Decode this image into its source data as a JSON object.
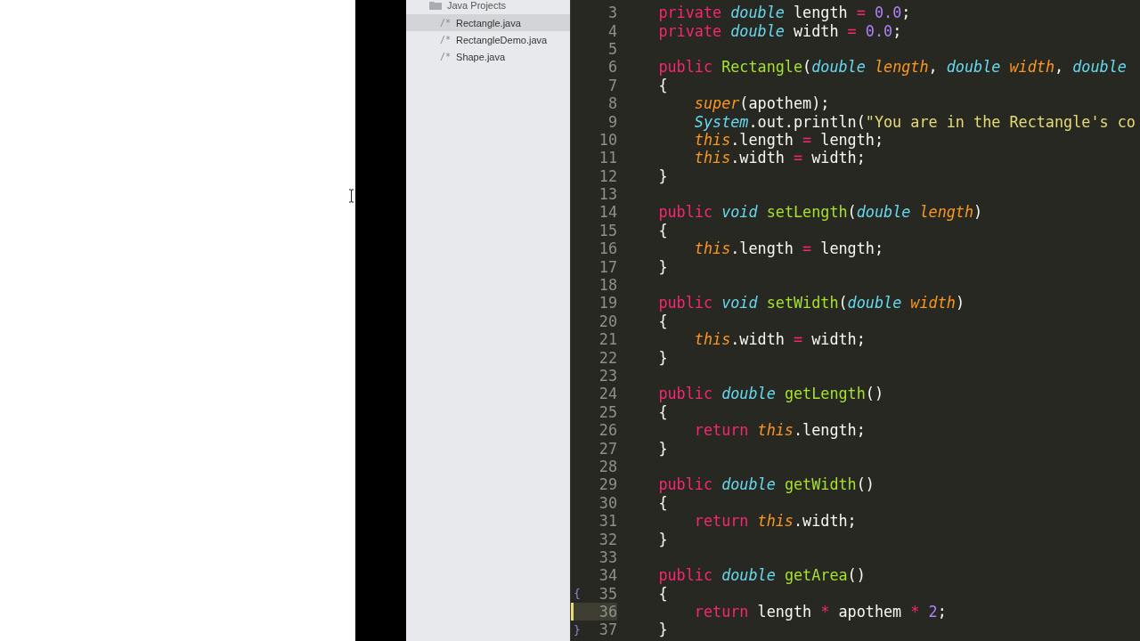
{
  "sidebar": {
    "header": "Java Projects",
    "items": [
      {
        "icon": "/*",
        "label": "Rectangle.java",
        "selected": true
      },
      {
        "icon": "/*",
        "label": "RectangleDemo.java",
        "selected": false
      },
      {
        "icon": "/*",
        "label": "Shape.java",
        "selected": false
      }
    ]
  },
  "editor": {
    "lines": [
      {
        "number": "3",
        "current": false,
        "tokens": [
          {
            "kind": "keyword",
            "text": "    private "
          },
          {
            "kind": "type",
            "text": "double"
          },
          {
            "kind": "plain",
            "text": " length "
          },
          {
            "kind": "operator",
            "text": "= "
          },
          {
            "kind": "number",
            "text": "0.0"
          },
          {
            "kind": "plain",
            "text": ";"
          }
        ]
      },
      {
        "number": "4",
        "current": false,
        "tokens": [
          {
            "kind": "keyword",
            "text": "    private "
          },
          {
            "kind": "type",
            "text": "double"
          },
          {
            "kind": "plain",
            "text": " width "
          },
          {
            "kind": "operator",
            "text": "= "
          },
          {
            "kind": "number",
            "text": "0.0"
          },
          {
            "kind": "plain",
            "text": ";"
          }
        ]
      },
      {
        "number": "5",
        "current": false
      },
      {
        "number": "6",
        "current": false,
        "tokens": [
          {
            "kind": "keyword",
            "text": "    public "
          },
          {
            "kind": "function",
            "text": "Rectangle"
          },
          {
            "kind": "plain",
            "text": "("
          },
          {
            "kind": "type",
            "text": "double "
          },
          {
            "kind": "parameter",
            "text": "length"
          },
          {
            "kind": "plain",
            "text": ", "
          },
          {
            "kind": "type",
            "text": "double "
          },
          {
            "kind": "parameter",
            "text": "width"
          },
          {
            "kind": "plain",
            "text": ", "
          },
          {
            "kind": "type",
            "text": "double"
          }
        ]
      },
      {
        "number": "7",
        "current": false,
        "tokens": [
          {
            "kind": "plain",
            "text": "    {"
          }
        ]
      },
      {
        "number": "8",
        "current": false,
        "tokens": [
          {
            "kind": "parameter",
            "text": "        super"
          },
          {
            "kind": "plain",
            "text": "(apothem);"
          }
        ]
      },
      {
        "number": "9",
        "current": false,
        "tokens": [
          {
            "kind": "type",
            "text": "        System"
          },
          {
            "kind": "plain",
            "text": ".out.println("
          },
          {
            "kind": "string",
            "text": "\"You are in the Rectangle's co"
          }
        ]
      },
      {
        "number": "10",
        "current": false,
        "tokens": [
          {
            "kind": "parameter",
            "text": "        this"
          },
          {
            "kind": "plain",
            "text": ".length "
          },
          {
            "kind": "operator",
            "text": "="
          },
          {
            "kind": "plain",
            "text": " length;"
          }
        ]
      },
      {
        "number": "11",
        "current": false,
        "tokens": [
          {
            "kind": "parameter",
            "text": "        this"
          },
          {
            "kind": "plain",
            "text": ".width "
          },
          {
            "kind": "operator",
            "text": "="
          },
          {
            "kind": "plain",
            "text": " width;"
          }
        ]
      },
      {
        "number": "12",
        "current": false,
        "tokens": [
          {
            "kind": "plain",
            "text": "    }"
          }
        ]
      },
      {
        "number": "13",
        "current": false
      },
      {
        "number": "14",
        "current": false,
        "tokens": [
          {
            "kind": "keyword",
            "text": "    public "
          },
          {
            "kind": "type",
            "text": "void "
          },
          {
            "kind": "function",
            "text": "setLength"
          },
          {
            "kind": "plain",
            "text": "("
          },
          {
            "kind": "type",
            "text": "double "
          },
          {
            "kind": "parameter",
            "text": "length"
          },
          {
            "kind": "plain",
            "text": ")"
          }
        ]
      },
      {
        "number": "15",
        "current": false,
        "tokens": [
          {
            "kind": "plain",
            "text": "    {"
          }
        ]
      },
      {
        "number": "16",
        "current": false,
        "tokens": [
          {
            "kind": "parameter",
            "text": "        this"
          },
          {
            "kind": "plain",
            "text": ".length "
          },
          {
            "kind": "operator",
            "text": "="
          },
          {
            "kind": "plain",
            "text": " length;"
          }
        ]
      },
      {
        "number": "17",
        "current": false,
        "tokens": [
          {
            "kind": "plain",
            "text": "    }"
          }
        ]
      },
      {
        "number": "18",
        "current": false
      },
      {
        "number": "19",
        "current": false,
        "tokens": [
          {
            "kind": "keyword",
            "text": "    public "
          },
          {
            "kind": "type",
            "text": "void "
          },
          {
            "kind": "function",
            "text": "setWidth"
          },
          {
            "kind": "plain",
            "text": "("
          },
          {
            "kind": "type",
            "text": "double "
          },
          {
            "kind": "parameter",
            "text": "width"
          },
          {
            "kind": "plain",
            "text": ")"
          }
        ]
      },
      {
        "number": "20",
        "current": false,
        "tokens": [
          {
            "kind": "plain",
            "text": "    {"
          }
        ]
      },
      {
        "number": "21",
        "current": false,
        "tokens": [
          {
            "kind": "parameter",
            "text": "        this"
          },
          {
            "kind": "plain",
            "text": ".width "
          },
          {
            "kind": "operator",
            "text": "="
          },
          {
            "kind": "plain",
            "text": " width;"
          }
        ]
      },
      {
        "number": "22",
        "current": false,
        "tokens": [
          {
            "kind": "plain",
            "text": "    }"
          }
        ]
      },
      {
        "number": "23",
        "current": false
      },
      {
        "number": "24",
        "current": false,
        "tokens": [
          {
            "kind": "keyword",
            "text": "    public "
          },
          {
            "kind": "type",
            "text": "double "
          },
          {
            "kind": "function",
            "text": "getLength"
          },
          {
            "kind": "plain",
            "text": "()"
          }
        ]
      },
      {
        "number": "25",
        "current": false,
        "tokens": [
          {
            "kind": "plain",
            "text": "    {"
          }
        ]
      },
      {
        "number": "26",
        "current": false,
        "tokens": [
          {
            "kind": "keyword",
            "text": "        return "
          },
          {
            "kind": "parameter",
            "text": "this"
          },
          {
            "kind": "plain",
            "text": ".length;"
          }
        ]
      },
      {
        "number": "27",
        "current": false,
        "tokens": [
          {
            "kind": "plain",
            "text": "    }"
          }
        ]
      },
      {
        "number": "28",
        "current": false
      },
      {
        "number": "29",
        "current": false,
        "tokens": [
          {
            "kind": "keyword",
            "text": "    public "
          },
          {
            "kind": "type",
            "text": "double "
          },
          {
            "kind": "function",
            "text": "getWidth"
          },
          {
            "kind": "plain",
            "text": "()"
          }
        ]
      },
      {
        "number": "30",
        "current": false,
        "tokens": [
          {
            "kind": "plain",
            "text": "    {"
          }
        ]
      },
      {
        "number": "31",
        "current": false,
        "tokens": [
          {
            "kind": "keyword",
            "text": "        return "
          },
          {
            "kind": "parameter",
            "text": "this"
          },
          {
            "kind": "plain",
            "text": ".width;"
          }
        ]
      },
      {
        "number": "32",
        "current": false,
        "tokens": [
          {
            "kind": "plain",
            "text": "    }"
          }
        ]
      },
      {
        "number": "33",
        "current": false
      },
      {
        "number": "34",
        "current": false,
        "tokens": [
          {
            "kind": "keyword",
            "text": "    public "
          },
          {
            "kind": "type",
            "text": "double "
          },
          {
            "kind": "function",
            "text": "getArea"
          },
          {
            "kind": "plain",
            "text": "()"
          }
        ]
      },
      {
        "number": "35",
        "current": false,
        "marker": "{",
        "tokens": [
          {
            "kind": "plain",
            "text": "    {"
          }
        ]
      },
      {
        "number": "36",
        "current": true,
        "tokens": [
          {
            "kind": "keyword",
            "text": "        return"
          },
          {
            "kind": "plain",
            "text": " length "
          },
          {
            "kind": "operator",
            "text": "*"
          },
          {
            "kind": "plain",
            "text": " apothem "
          },
          {
            "kind": "operator",
            "text": "*"
          },
          {
            "kind": "number",
            "text": " 2"
          },
          {
            "kind": "plain",
            "text": ";"
          }
        ]
      },
      {
        "number": "37",
        "current": false,
        "marker": "}",
        "tokens": [
          {
            "kind": "plain",
            "text": "    }"
          }
        ]
      }
    ]
  }
}
